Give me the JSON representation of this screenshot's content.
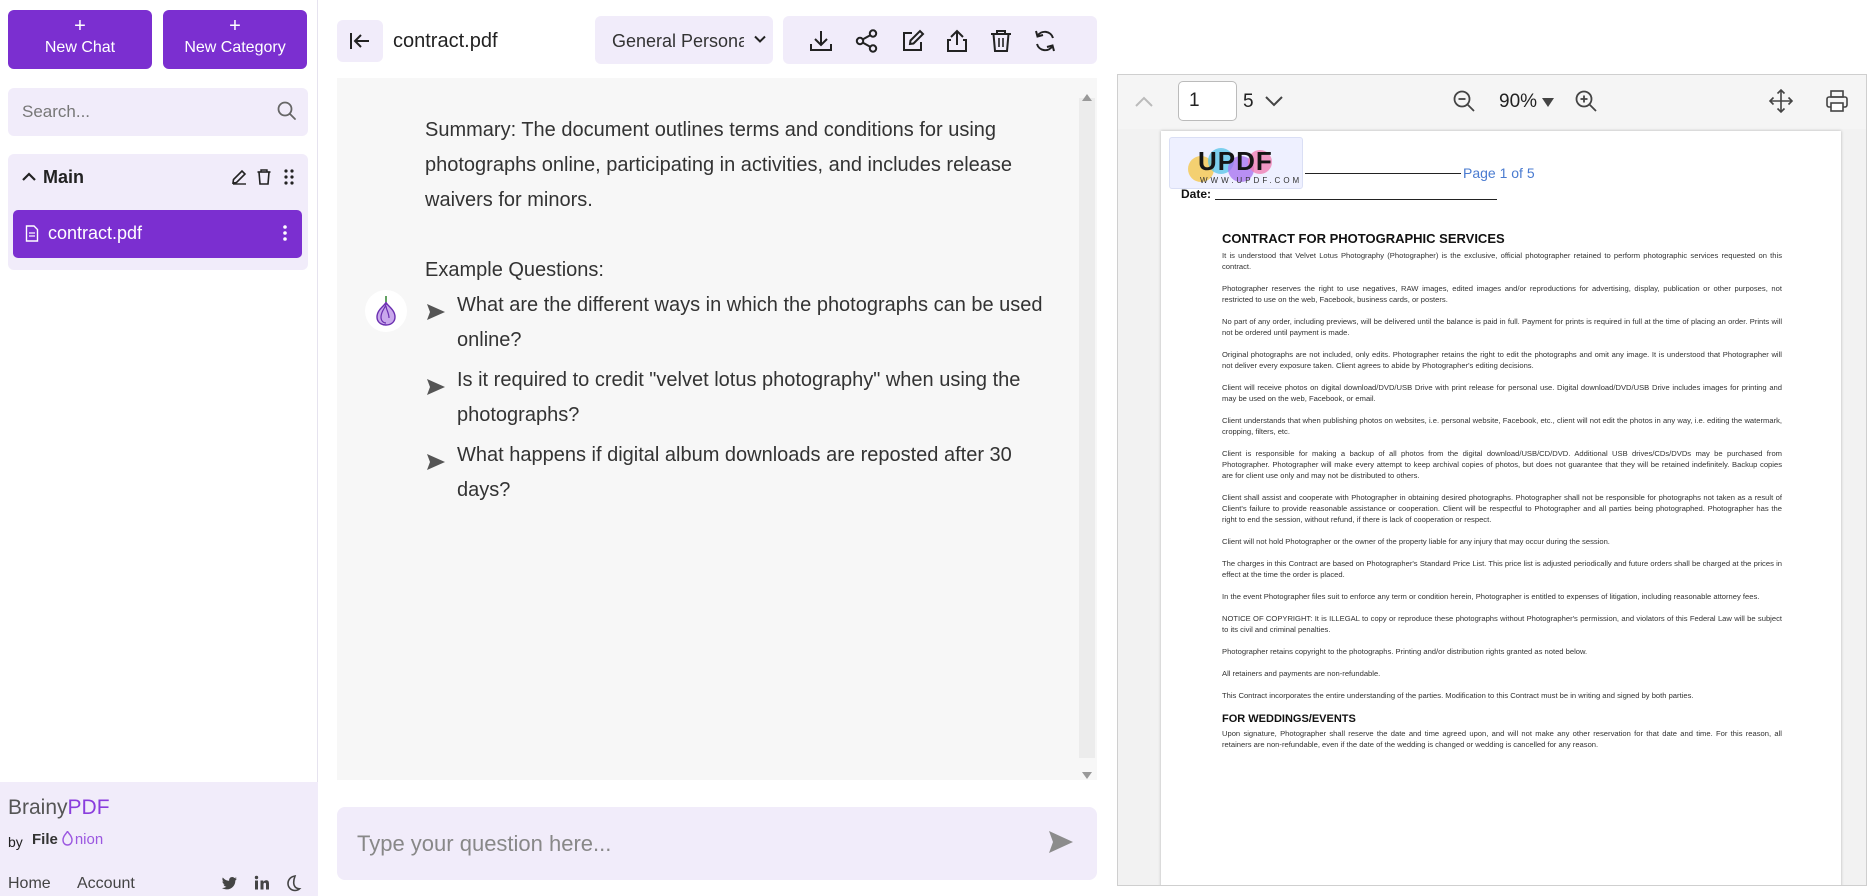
{
  "sidebar": {
    "new_chat_label": "New Chat",
    "new_category_label": "New Category",
    "plus_icon": "+",
    "search_placeholder": "Search...",
    "category": {
      "title": "Main",
      "files": [
        {
          "name": "contract.pdf"
        }
      ]
    },
    "brand_prefix": "Brainy",
    "brand_suffix": "PDF",
    "by_label": "by",
    "file_onion_a": "File",
    "file_onion_b": "nion",
    "footer_links": {
      "home": "Home",
      "account": "Account"
    }
  },
  "chat": {
    "title": "contract.pdf",
    "persona": "General Persona",
    "toolbar": [
      "download-icon",
      "share-icon",
      "edit-icon",
      "upload-icon",
      "trash-icon",
      "refresh-icon"
    ],
    "summary": "Summary: The document outlines terms and conditions for using photographs online, participating in activities, and includes release waivers for minors.",
    "example_label": "Example Questions:",
    "questions": [
      "What are the different ways in which the photographs can be used online?",
      "Is it required to credit \"velvet lotus photography\" when using the photographs?",
      "What happens if digital album downloads are reposted after 30 days?"
    ],
    "input_placeholder": "Type your question here..."
  },
  "viewer": {
    "current_page": "1",
    "total_pages": "5",
    "zoom": "90%",
    "logo_word": "UPDF",
    "logo_url": "WWW.UPDF.COM",
    "page_of": "Page 1 of 5",
    "date_label": "Date:",
    "doc_title": "CONTRACT FOR PHOTOGRAPHIC SERVICES",
    "paragraphs": [
      "It is understood that Velvet Lotus Photography (Photographer) is the exclusive, official photographer retained to perform photographic services requested on this contract.",
      "Photographer reserves the right to use negatives, RAW images, edited images and/or reproductions for advertising, display, publication or other purposes, not restricted to use on the web, Facebook, business cards, or posters.",
      "No part of any order, including previews, will be delivered until the balance is paid in full. Payment for prints is required in full at the time of placing an order. Prints will not be ordered until payment is made.",
      "Original photographs are not included, only edits. Photographer retains the right to edit the photographs and omit any image. It is understood that Photographer will not deliver every exposure taken. Client agrees to abide by Photographer's editing decisions.",
      "Client will receive photos on digital download/DVD/USB Drive with print release for personal use. Digital download/DVD/USB Drive includes images for printing and may be used on the web, Facebook, or email.",
      "Client understands that when publishing photos on websites, i.e. personal website, Facebook, etc., client will not edit the photos in any way, i.e. editing the watermark, cropping, filters, etc.",
      "Client is responsible for making a backup of all photos from the digital download/USB/CD/DVD. Additional USB drives/CDs/DVDs may be purchased from Photographer. Photographer will make every attempt to keep archival copies of photos, but does not guarantee that they will be retained indefinitely. Backup copies are for client use only and may not be distributed to others.",
      "Client shall assist and cooperate with Photographer in obtaining desired photographs. Photographer shall not be responsible for photographs not taken as a result of Client's failure to provide reasonable assistance or cooperation. Client will be respectful to Photographer and all parties being photographed. Photographer has the right to end the session, without refund, if there is lack of cooperation or respect.",
      "Client will not hold Photographer or the owner of the property liable for any injury that may occur during the session.",
      "The charges in this Contract are based on Photographer's Standard Price List. This price list is adjusted periodically and future orders shall be charged at the prices in effect at the time the order is placed.",
      "In the event Photographer files suit to enforce any term or condition herein, Photographer is entitled to expenses of litigation, including reasonable attorney fees.",
      "NOTICE OF COPYRIGHT: It is ILLEGAL to copy or reproduce these photographs without Photographer's permission, and violators of this Federal Law will be subject to its civil and criminal penalties.",
      "Photographer retains copyright to the photographs. Printing and/or distribution rights granted as noted below.",
      "All retainers and payments are non-refundable.",
      "This Contract incorporates the entire understanding of the parties. Modification to this Contract must be in writing and signed by both parties."
    ],
    "section2_title": "FOR WEDDINGS/EVENTS",
    "section2_text": "Upon signature, Photographer shall reserve the date and time agreed upon, and will not make any other reservation for that date and time. For this reason, all retainers are non-refundable, even if the date of the wedding is changed or wedding is cancelled for any reason."
  },
  "colors": {
    "accent": "#7b2fd0",
    "panel": "#f1ecfa",
    "link_blue": "#4a7bd0"
  }
}
